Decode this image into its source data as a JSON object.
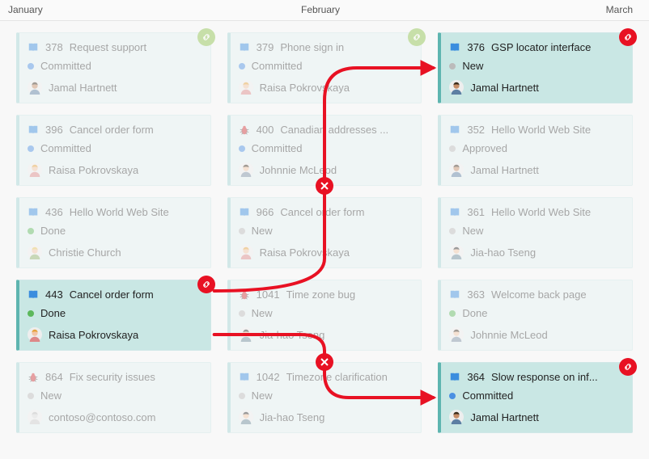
{
  "months": {
    "jan": "January",
    "feb": "February",
    "mar": "March"
  },
  "statuses": {
    "committed": "Committed",
    "new": "New",
    "done": "Done",
    "approved": "Approved"
  },
  "people": {
    "jamal": "Jamal Hartnett",
    "raisa": "Raisa Pokrovskaya",
    "christie": "Christie Church",
    "johnnie": "Johnnie McLeod",
    "jiahao": "Jia-hao Tseng",
    "contoso": "contoso@contoso.com"
  },
  "columns": {
    "jan": [
      {
        "id": 378,
        "type": "book",
        "title": "Request support",
        "status": "committed",
        "assignee": "jamal",
        "badge": "green",
        "active": false
      },
      {
        "id": 396,
        "type": "book",
        "title": "Cancel order form",
        "status": "committed",
        "assignee": "raisa",
        "badge": null,
        "active": false
      },
      {
        "id": 436,
        "type": "book",
        "title": "Hello World Web Site",
        "status": "done",
        "assignee": "christie",
        "badge": null,
        "active": false
      },
      {
        "id": 443,
        "type": "book",
        "title": "Cancel order form",
        "status": "done",
        "assignee": "raisa",
        "badge": "red",
        "active": true
      },
      {
        "id": 864,
        "type": "bug",
        "title": "Fix security issues",
        "status": "new",
        "assignee": "contoso",
        "badge": null,
        "active": false
      }
    ],
    "feb": [
      {
        "id": 379,
        "type": "book",
        "title": "Phone sign in",
        "status": "committed",
        "assignee": "raisa",
        "badge": "green",
        "active": false
      },
      {
        "id": 400,
        "type": "bug",
        "title": "Canadian addresses ...",
        "status": "committed",
        "assignee": "johnnie",
        "badge": null,
        "active": false
      },
      {
        "id": 966,
        "type": "book",
        "title": "Cancel order form",
        "status": "new",
        "assignee": "raisa",
        "badge": null,
        "active": false
      },
      {
        "id": 1041,
        "type": "bug",
        "title": "Time zone bug",
        "status": "new",
        "assignee": "jiahao",
        "badge": null,
        "active": false
      },
      {
        "id": 1042,
        "type": "book",
        "title": "Timezone clarification",
        "status": "new",
        "assignee": "jiahao",
        "badge": null,
        "active": false
      }
    ],
    "mar": [
      {
        "id": 376,
        "type": "book",
        "title": "GSP locator interface",
        "status": "new",
        "assignee": "jamal",
        "badge": "red",
        "active": true
      },
      {
        "id": 352,
        "type": "book",
        "title": "Hello World Web Site",
        "status": "approved",
        "assignee": "jamal",
        "badge": null,
        "active": false
      },
      {
        "id": 361,
        "type": "book",
        "title": "Hello World Web Site",
        "status": "new",
        "assignee": "jiahao",
        "badge": null,
        "active": false
      },
      {
        "id": 363,
        "type": "book",
        "title": "Welcome back page",
        "status": "done",
        "assignee": "johnnie",
        "badge": null,
        "active": false
      },
      {
        "id": 364,
        "type": "book",
        "title": "Slow response on inf...",
        "status": "committed",
        "assignee": "jamal",
        "badge": "red",
        "active": true
      }
    ]
  },
  "avatarColors": {
    "jamal": {
      "skin": "#c68d68",
      "hair": "#3a2a1a",
      "body": "#5d7fa3"
    },
    "raisa": {
      "skin": "#f3c6a5",
      "hair": "#e6a23c",
      "body": "#d88"
    },
    "christie": {
      "skin": "#f3c6a5",
      "hair": "#e6c65c",
      "body": "#8fb36b"
    },
    "johnnie": {
      "skin": "#f3c6a5",
      "hair": "#3a2a1a",
      "body": "#7b8fa3"
    },
    "jiahao": {
      "skin": "#f3c6a5",
      "hair": "#2a2a2a",
      "body": "#6b8b9b"
    },
    "contoso": {
      "skin": "#ddd",
      "hair": "#bbb",
      "body": "#ccc"
    }
  }
}
